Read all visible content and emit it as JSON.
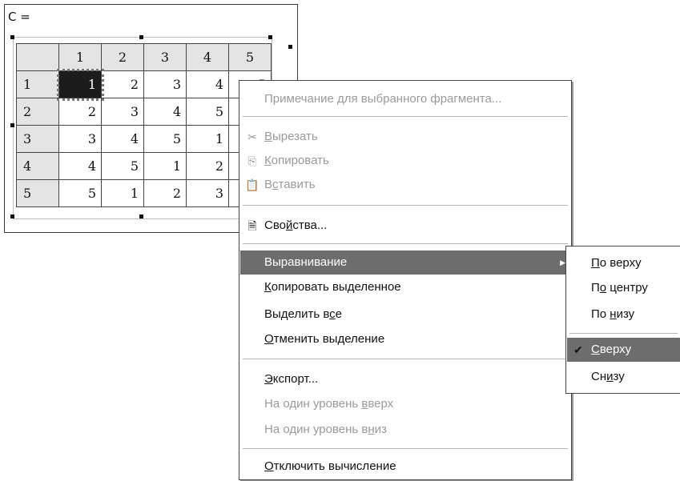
{
  "region": {
    "label": "C =",
    "col_headers": [
      "1",
      "2",
      "3",
      "4",
      "5"
    ],
    "rows": [
      {
        "head": "1",
        "cells": [
          "1",
          "2",
          "3",
          "4",
          "5"
        ]
      },
      {
        "head": "2",
        "cells": [
          "2",
          "3",
          "4",
          "5",
          ""
        ]
      },
      {
        "head": "3",
        "cells": [
          "3",
          "4",
          "5",
          "1",
          ""
        ]
      },
      {
        "head": "4",
        "cells": [
          "4",
          "5",
          "1",
          "2",
          ""
        ]
      },
      {
        "head": "5",
        "cells": [
          "5",
          "1",
          "2",
          "3",
          ""
        ]
      }
    ]
  },
  "menu": {
    "note": "Примечание для выбранного фрагмента...",
    "cut": {
      "pre": "",
      "u": "В",
      "post": "ырезать"
    },
    "copy": {
      "pre": "",
      "u": "К",
      "post": "опировать"
    },
    "paste": {
      "pre": "В",
      "u": "с",
      "post": "тавить"
    },
    "properties": {
      "pre": "Сво",
      "u": "й",
      "post": "ства..."
    },
    "align": "Выравнивание",
    "copy_selected": {
      "pre": "",
      "u": "К",
      "post": "опировать выделенное"
    },
    "select_all": {
      "pre": "Выделить в",
      "u": "с",
      "post": "е"
    },
    "deselect": {
      "pre": "",
      "u": "О",
      "post": "тменить выделение"
    },
    "export": {
      "pre": "",
      "u": "Э",
      "post": "кспорт..."
    },
    "level_up": {
      "pre": "На один уровень ",
      "u": "в",
      "post": "верх"
    },
    "level_down": {
      "pre": "На один уровень в",
      "u": "н",
      "post": "из"
    },
    "disable_calc": {
      "pre": "",
      "u": "О",
      "post": "тключить вычисление"
    }
  },
  "submenu": {
    "top": {
      "pre": "",
      "u": "П",
      "post": "о верху"
    },
    "center": {
      "pre": "П",
      "u": "о",
      "post": " центру"
    },
    "bottom": {
      "pre": "По ",
      "u": "н",
      "post": "изу"
    },
    "above": {
      "pre": "",
      "u": "С",
      "post": "верху"
    },
    "below": {
      "pre": "Сн",
      "u": "и",
      "post": "зу"
    },
    "check_mark": "✔"
  },
  "colors": {
    "highlight": "#6d6d6d",
    "disabled": "#9a9a9a",
    "header_bg": "#e4e4e4"
  }
}
